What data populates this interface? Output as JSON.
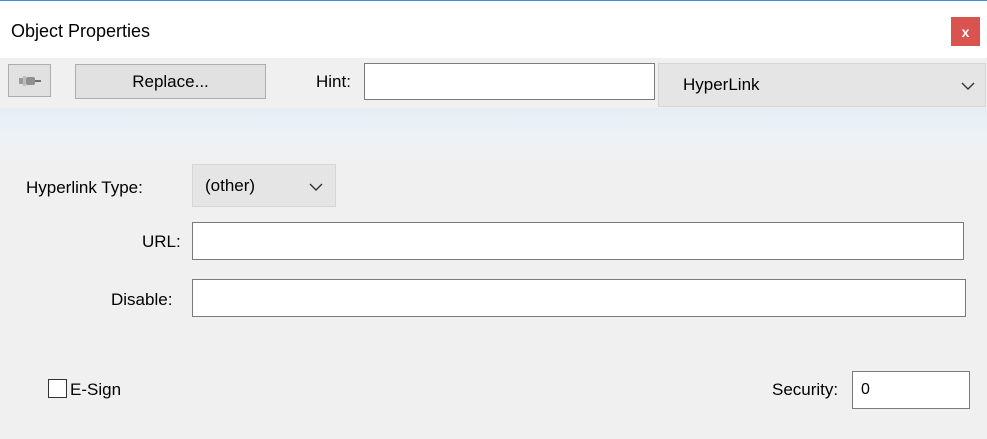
{
  "window": {
    "title": "Object Properties",
    "close_label": "x"
  },
  "toolbar": {
    "pin_icon": "pushpin-icon",
    "replace_label": "Replace...",
    "hint_label": "Hint:",
    "hint_value": "",
    "object_type_selected": "HyperLink"
  },
  "form": {
    "hyperlink_type_label": "Hyperlink Type:",
    "hyperlink_type_selected": "(other)",
    "url_label": "URL:",
    "url_value": "",
    "disable_label": "Disable:",
    "disable_value": ""
  },
  "footer": {
    "esign_label": "E-Sign",
    "esign_checked": false,
    "security_label": "Security:",
    "security_value": "0"
  },
  "colors": {
    "close_button": "#d9534f",
    "title_border": "#3b8fd8",
    "background": "#f0f0f0"
  }
}
